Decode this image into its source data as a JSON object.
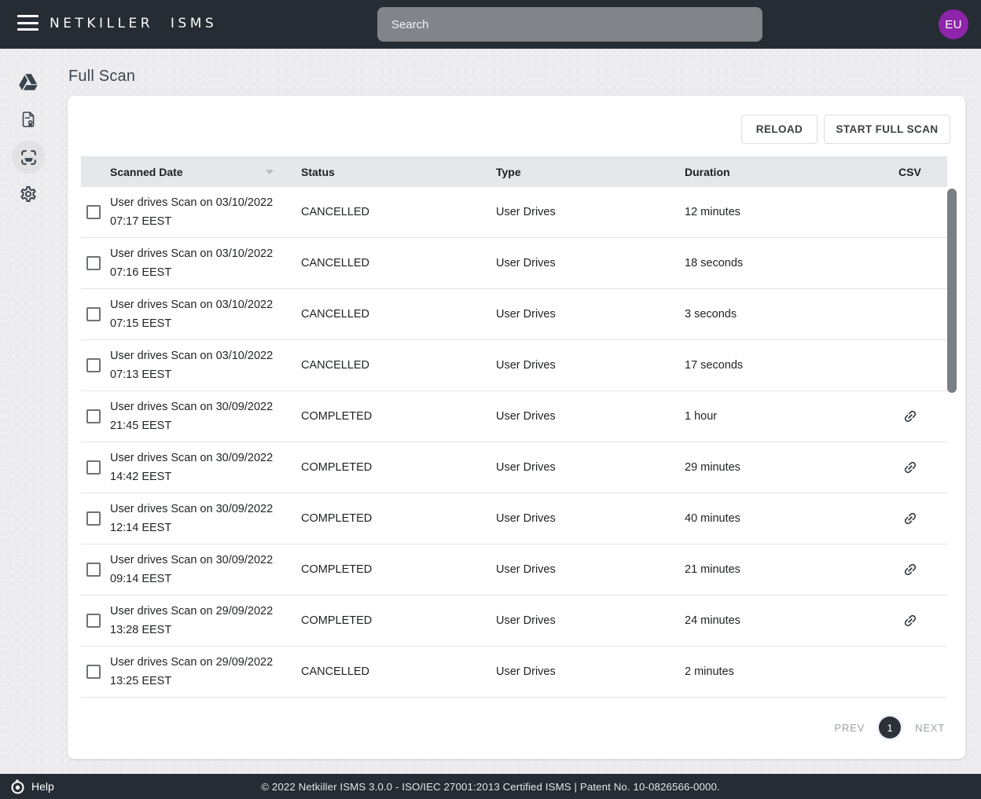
{
  "header": {
    "logo_text": "NETKILLER ISMS",
    "search": {
      "placeholder": "Search"
    },
    "avatar_initials": "EU"
  },
  "sidebar": {
    "items": [
      {
        "icon": "google-drive-icon",
        "active": false
      },
      {
        "icon": "certificate-document-icon",
        "active": false
      },
      {
        "icon": "scanner-icon",
        "active": true
      },
      {
        "icon": "settings-gear-icon",
        "active": false
      }
    ]
  },
  "page": {
    "title": "Full Scan"
  },
  "toolbar": {
    "reload_label": "RELOAD",
    "start_full_scan_label": "START FULL SCAN"
  },
  "table": {
    "columns": {
      "scanned_date": "Scanned Date",
      "status": "Status",
      "type": "Type",
      "duration": "Duration",
      "csv": "CSV"
    },
    "sort": {
      "column": "Scanned Date",
      "direction": "desc"
    },
    "rows": [
      {
        "scanned_date": "User drives Scan on 03/10/2022 07:17 EEST",
        "status": "CANCELLED",
        "type": "User Drives",
        "duration": "12 minutes",
        "csv": false
      },
      {
        "scanned_date": "User drives Scan on 03/10/2022 07:16 EEST",
        "status": "CANCELLED",
        "type": "User Drives",
        "duration": "18 seconds",
        "csv": false
      },
      {
        "scanned_date": "User drives Scan on 03/10/2022 07:15 EEST",
        "status": "CANCELLED",
        "type": "User Drives",
        "duration": "3 seconds",
        "csv": false
      },
      {
        "scanned_date": "User drives Scan on 03/10/2022 07:13 EEST",
        "status": "CANCELLED",
        "type": "User Drives",
        "duration": "17 seconds",
        "csv": false
      },
      {
        "scanned_date": "User drives Scan on 30/09/2022 21:45 EEST",
        "status": "COMPLETED",
        "type": "User Drives",
        "duration": "1 hour",
        "csv": true
      },
      {
        "scanned_date": "User drives Scan on 30/09/2022 14:42 EEST",
        "status": "COMPLETED",
        "type": "User Drives",
        "duration": "29 minutes",
        "csv": true
      },
      {
        "scanned_date": "User drives Scan on 30/09/2022 12:14 EEST",
        "status": "COMPLETED",
        "type": "User Drives",
        "duration": "40 minutes",
        "csv": true
      },
      {
        "scanned_date": "User drives Scan on 30/09/2022 09:14 EEST",
        "status": "COMPLETED",
        "type": "User Drives",
        "duration": "21 minutes",
        "csv": true
      },
      {
        "scanned_date": "User drives Scan on 29/09/2022 13:28 EEST",
        "status": "COMPLETED",
        "type": "User Drives",
        "duration": "24 minutes",
        "csv": true
      },
      {
        "scanned_date": "User drives Scan on 29/09/2022 13:25 EEST",
        "status": "CANCELLED",
        "type": "User Drives",
        "duration": "2 minutes",
        "csv": false
      }
    ]
  },
  "pagination": {
    "prev_label": "PREV",
    "current_page": "1",
    "next_label": "NEXT"
  },
  "footer": {
    "help_label": "Help",
    "copyright": "© 2022 Netkiller ISMS 3.0.0 - ISO/IEC 27001:2013 Certified ISMS  |  Patent No. 10-0826566-0000."
  },
  "colors": {
    "topbar_bg": "#262c33",
    "avatar_bg": "#8e24aa",
    "page_bg": "#ececee",
    "table_header_bg": "#e6e7ea",
    "active_page_bg": "#2c3238"
  }
}
